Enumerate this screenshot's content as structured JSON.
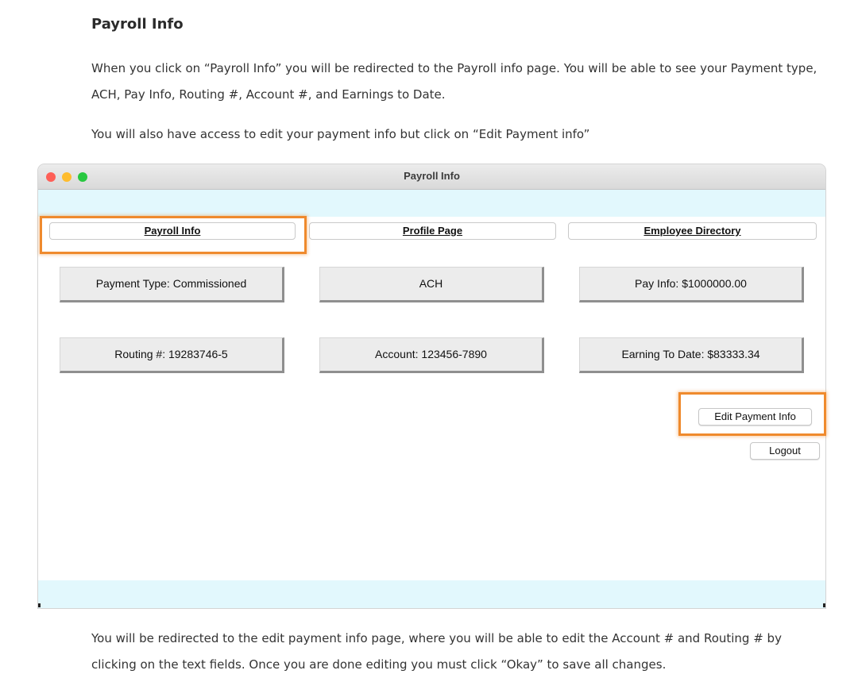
{
  "document": {
    "heading": "Payroll Info",
    "paragraph1": "When you click on “Payroll Info” you will be redirected to the Payroll info page. You will be able to see your Payment type, ACH, Pay Info, Routing #, Account #, and Earnings to Date.",
    "paragraph2": "You will also have access to edit your payment info but click on “Edit Payment info”",
    "paragraph3": "You will be redirected to the edit payment info page, where you will be able to edit the Account # and Routing # by clicking on the text fields. Once you are done editing you must click “Okay” to save all changes."
  },
  "window": {
    "title": "Payroll Info",
    "tabs": [
      {
        "label": "Payroll Info"
      },
      {
        "label": "Profile Page"
      },
      {
        "label": "Employee Directory"
      }
    ],
    "info_buttons": [
      {
        "label": "Payment Type: Commissioned"
      },
      {
        "label": "ACH"
      },
      {
        "label": "Pay Info: $1000000.00"
      },
      {
        "label": "Routing #: 19283746-5"
      },
      {
        "label": "Account: 123456-7890"
      },
      {
        "label": "Earning To Date: $83333.34"
      }
    ],
    "edit_button": "Edit Payment Info",
    "logout_button": "Logout"
  },
  "colors": {
    "highlight": "#ef8a2d",
    "band": "#e2f8fd",
    "close": "#fe5f57",
    "minimize": "#febc2e",
    "maximize": "#28c840"
  }
}
